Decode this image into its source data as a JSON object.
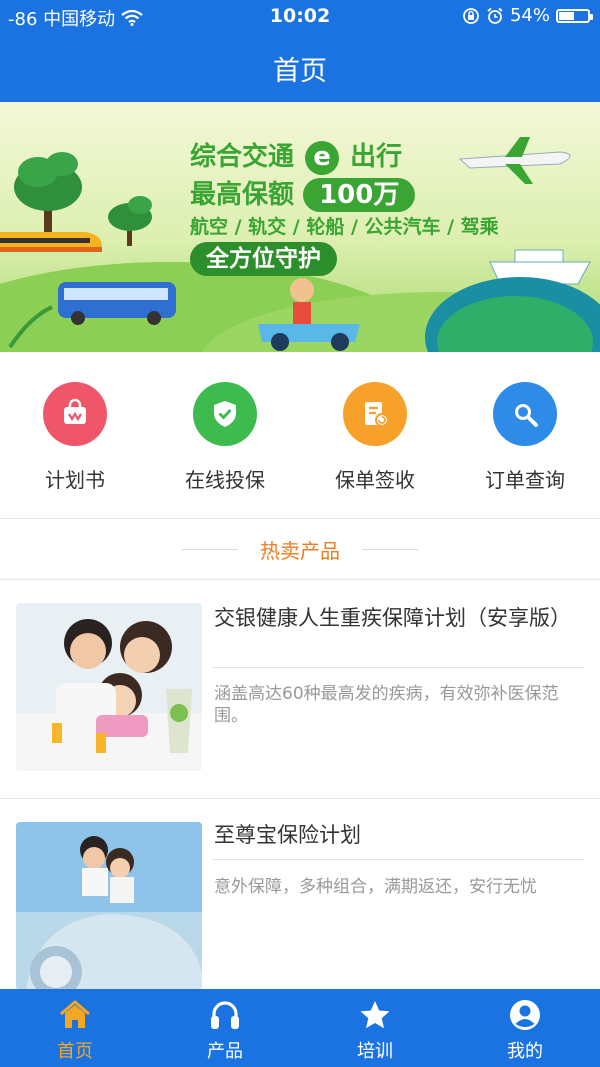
{
  "status_bar": {
    "carrier": "-86 中国移动",
    "time": "10:02",
    "battery": "54%",
    "battery_level": 0.54
  },
  "nav": {
    "title": "首页"
  },
  "banner": {
    "line1_a": "综合交通",
    "line1_e": "e",
    "line1_b": "出行",
    "line2_a": "最高保额",
    "line2_b": "100万",
    "line3": "航空 / 轨交 / 轮船 / 公共汽车 / 驾乘",
    "line4": "全方位守护"
  },
  "quick_menu": [
    {
      "label": "计划书",
      "color": "#f0566a",
      "icon": "bag-icon"
    },
    {
      "label": "在线投保",
      "color": "#3dbb4f",
      "icon": "shield-check-icon"
    },
    {
      "label": "保单签收",
      "color": "#f7a12b",
      "icon": "document-sign-icon"
    },
    {
      "label": "订单查询",
      "color": "#2e8be8",
      "icon": "search-icon"
    }
  ],
  "section": {
    "title": "热卖产品"
  },
  "products": [
    {
      "title": "交银健康人生重疾保障计划（安享版）",
      "desc": "涵盖高达60种最高发的疾病，有效弥补医保范围。"
    },
    {
      "title": "至尊宝保险计划",
      "desc": "意外保障，多种组合，满期返还，安行无忧"
    }
  ],
  "tabs": [
    {
      "label": "首页",
      "icon": "home-icon",
      "active": true
    },
    {
      "label": "产品",
      "icon": "headset-icon",
      "active": false
    },
    {
      "label": "培训",
      "icon": "star-icon",
      "active": false
    },
    {
      "label": "我的",
      "icon": "user-icon",
      "active": false
    }
  ],
  "colors": {
    "primary": "#1a73e0",
    "accent": "#f5a623",
    "section_title": "#ee7d1e",
    "banner_green": "#3aa533"
  }
}
